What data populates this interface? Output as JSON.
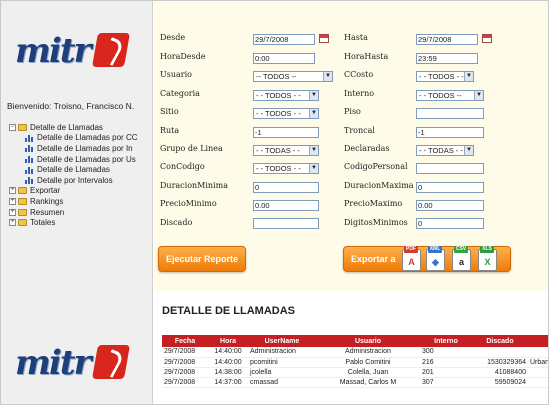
{
  "welcome": "Bienvenido: Troisno, Francisco N.",
  "tree": {
    "root": "Detalle de Llamadas",
    "children": [
      "Detalle de Llamadas por CC",
      "Detalle de Llamadas por In",
      "Detalle de Llamadas por Us",
      "Detalle de Llamadas",
      "Detalle por Intervalos"
    ],
    "others": [
      "Exportar",
      "Rankings",
      "Resumen",
      "Totales"
    ]
  },
  "form": {
    "desde_label": "Desde",
    "desde_value": "29/7/2008",
    "hasta_label": "Hasta",
    "hasta_value": "29/7/2008",
    "horadesde_label": "HoraDesde",
    "horadesde_value": "0:00",
    "horahasta_label": "HoraHasta",
    "horahasta_value": "23:59",
    "usuario_label": "Usuario",
    "usuario_value": "-- TODOS --",
    "ccosto_label": "CCosto",
    "ccosto_value": "- - TODOS - -",
    "categoria_label": "Categoria",
    "categoria_value": "- - TODOS - -",
    "interno_label": "Interno",
    "interno_value": "- - TODOS --",
    "sitio_label": "Sitio",
    "sitio_value": "- - TODOS - -",
    "piso_label": "Piso",
    "piso_value": "",
    "ruta_label": "Ruta",
    "ruta_value": "-1",
    "troncal_label": "Troncal",
    "troncal_value": "-1",
    "grupo_label": "Grupo de Linea",
    "grupo_value": "- - TODAS - -",
    "declaradas_label": "Declaradas",
    "declaradas_value": "- - TODAS - -",
    "concodigo_label": "ConCodigo",
    "concodigo_value": "- - TODOS - -",
    "codigopersonal_label": "CodigoPersonal",
    "codigopersonal_value": "",
    "duracionminima_label": "DuracionMinima",
    "duracionminima_value": "0",
    "duracionmaxima_label": "DuracionMaxima",
    "duracionmaxima_value": "0",
    "preciominimo_label": "PrecioMinimo",
    "preciominimo_value": "0.00",
    "preciomaximo_label": "PrecioMaximo",
    "preciomaximo_value": "0.00",
    "discado_label": "Discado",
    "discado_value": "",
    "digitosminimos_label": "DigitosMinimos",
    "digitosminimos_value": "0"
  },
  "buttons": {
    "ejecutar": "Ejecutar Reporte",
    "exportar": "Exportar a"
  },
  "export_icons": [
    {
      "name": "pdf-export-icon",
      "tag": "PDF",
      "glyph": "A",
      "tag_color": "#d83a2a",
      "glyph_color": "#d83a2a"
    },
    {
      "name": "xml-export-icon",
      "tag": "XML",
      "glyph": "◆",
      "tag_color": "#3a73c9",
      "glyph_color": "#3a73c9"
    },
    {
      "name": "csv-export-icon",
      "tag": "CSV",
      "glyph": "a",
      "tag_color": "#3aa140",
      "glyph_color": "#222222"
    },
    {
      "name": "xls-export-icon",
      "tag": "XLS",
      "glyph": "X",
      "tag_color": "#2f9a3a",
      "glyph_color": "#2f9a3a"
    }
  ],
  "report": {
    "title": "DETALLE DE LLAMADAS",
    "columns": [
      "Fecha",
      "Hora",
      "UserName",
      "Usuario",
      "Interno",
      "Discado",
      ""
    ],
    "rows": [
      [
        "29/7/2008",
        "14:40:00",
        "Administracion",
        "Administracion",
        "300",
        "",
        ""
      ],
      [
        "29/7/2008",
        "14:40:00",
        "pcomitini",
        "Pablo Comitini",
        "216",
        "1530329364",
        "Urban"
      ],
      [
        "29/7/2008",
        "14:38:00",
        "jcolella",
        "Colella, Juan",
        "201",
        "41088400",
        ""
      ],
      [
        "29/7/2008",
        "14:37:00",
        "cmassad",
        "Massad, Carlos M",
        "307",
        "59509024",
        ""
      ]
    ]
  }
}
